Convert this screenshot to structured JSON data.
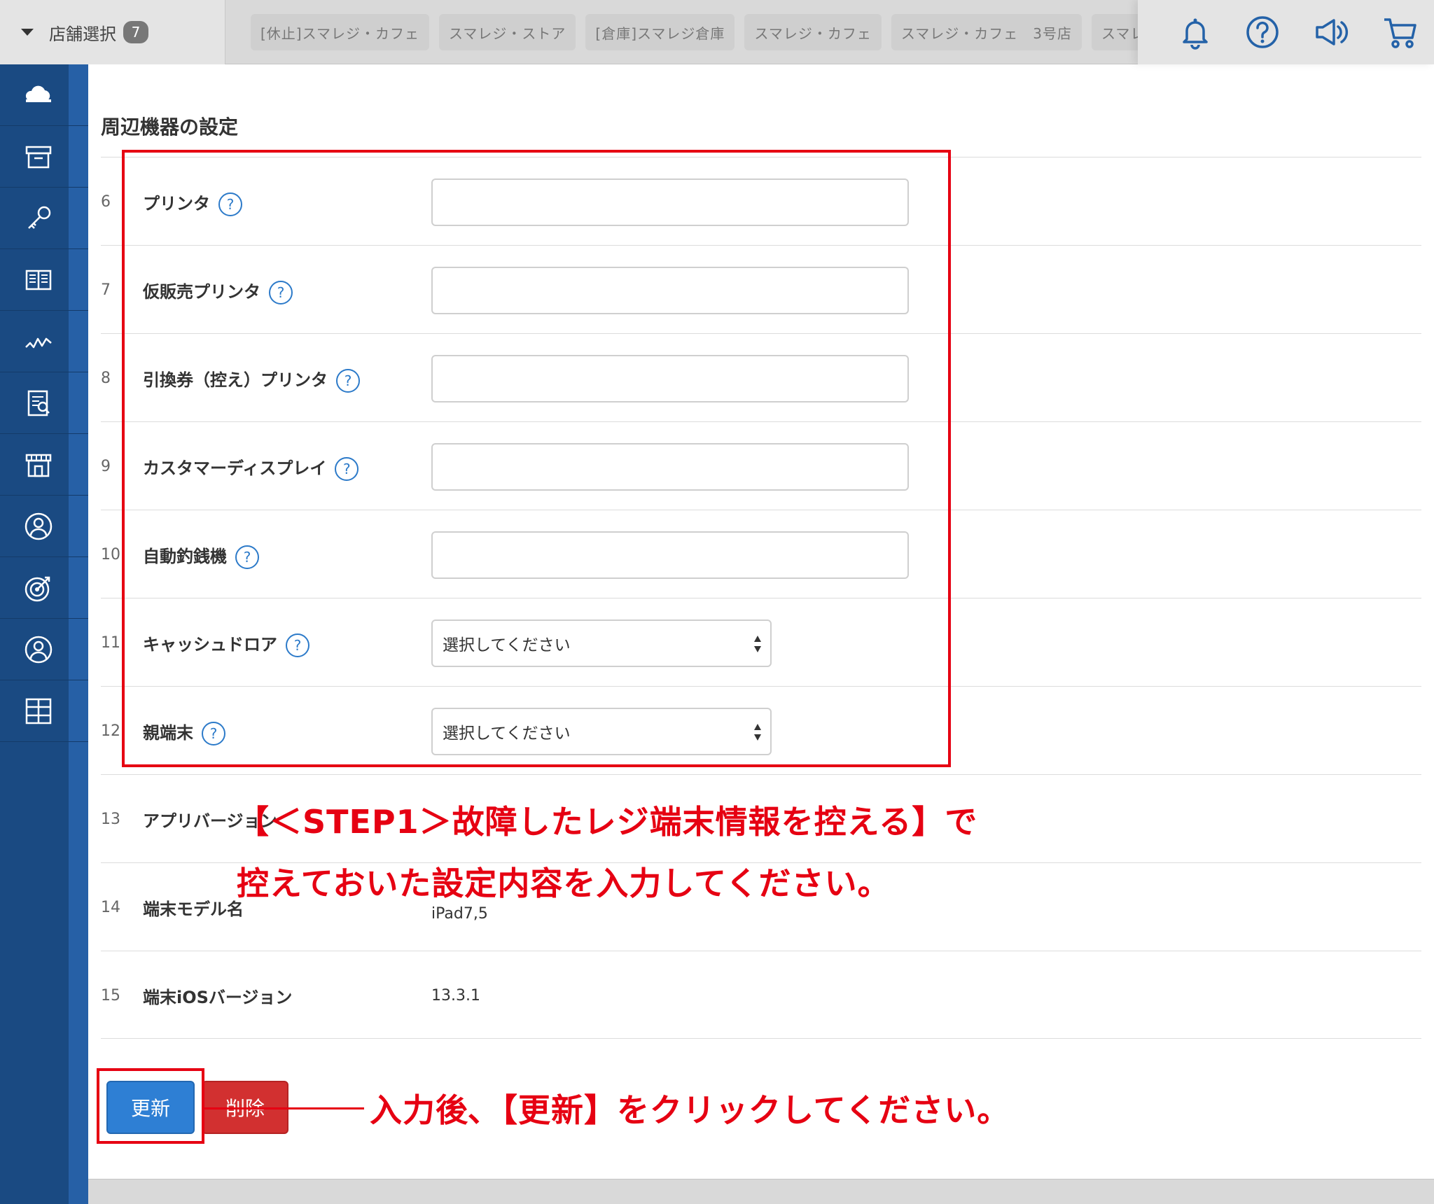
{
  "topbar": {
    "store_select_label": "店舗選択",
    "store_count": "7",
    "store_tabs": [
      "[休止]スマレジ・カフェ",
      "スマレジ・ストア",
      "[倉庫]スマレジ倉庫",
      "スマレジ・カフェ",
      "スマレジ・カフェ　3号店",
      "スマレジ・カフェ"
    ],
    "icons": [
      "bell-icon",
      "help-icon",
      "megaphone-icon",
      "cart-icon"
    ]
  },
  "sidebar": {
    "icons": [
      "cloud-icon",
      "archive-box-icon",
      "key-icon",
      "book-icon",
      "line-chart-icon",
      "report-icon",
      "store-icon",
      "customer-icon",
      "target-icon",
      "user-icon",
      "grid-icon"
    ]
  },
  "section": {
    "title": "周辺機器の設定"
  },
  "help_glyph": "?",
  "rows": [
    {
      "num": "6",
      "label": "プリンタ",
      "value": ""
    },
    {
      "num": "7",
      "label": "仮販売プリンタ",
      "value": ""
    },
    {
      "num": "8",
      "label": "引換券（控え）プリンタ",
      "value": ""
    },
    {
      "num": "9",
      "label": "カスタマーディスプレイ",
      "value": ""
    },
    {
      "num": "10",
      "label": "自動釣銭機",
      "value": ""
    },
    {
      "num": "11",
      "label": "キャッシュドロア",
      "selected": "選択してください"
    },
    {
      "num": "12",
      "label": "親端末",
      "selected": "選択してください"
    },
    {
      "num": "13",
      "label": "アプリバージョン",
      "value": ""
    },
    {
      "num": "14",
      "label": "端末モデル名",
      "value": "iPad7,5"
    },
    {
      "num": "15",
      "label": "端末iOSバージョン",
      "value": "13.3.1"
    }
  ],
  "annotations": {
    "line1": "【＜STEP1＞故障したレジ端末情報を控える】で",
    "line2": "控えておいた設定内容を入力してください。",
    "callout": "入力後､【更新】をクリックしてください。"
  },
  "buttons": {
    "update": "更新",
    "delete": "削除"
  },
  "colors": {
    "sidebar": "#1a4a82",
    "accent_red": "#e60012",
    "update_blue": "#2e7fd4",
    "delete_red": "#d23030",
    "help_blue": "#2c7ac9"
  }
}
